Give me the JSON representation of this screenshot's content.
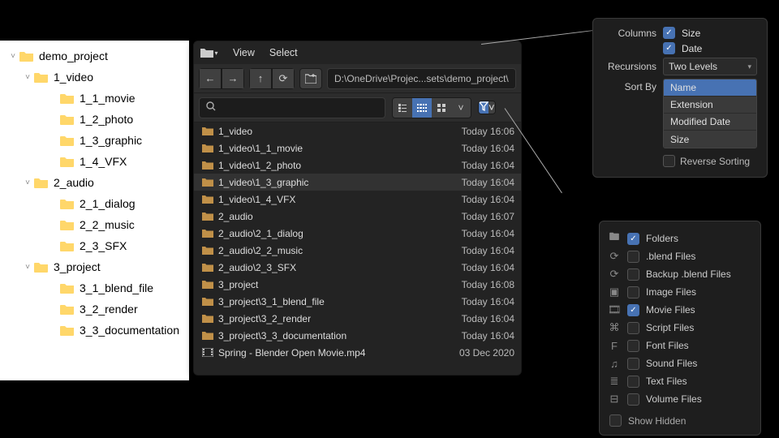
{
  "tree": {
    "root": {
      "label": "demo_project"
    },
    "nodes": [
      {
        "label": "1_video",
        "depth": 1,
        "expanded": true
      },
      {
        "label": "1_1_movie",
        "depth": 2
      },
      {
        "label": "1_2_photo",
        "depth": 2
      },
      {
        "label": "1_3_graphic",
        "depth": 2
      },
      {
        "label": "1_4_VFX",
        "depth": 2
      },
      {
        "label": "2_audio",
        "depth": 1,
        "expanded": true
      },
      {
        "label": "2_1_dialog",
        "depth": 2
      },
      {
        "label": "2_2_music",
        "depth": 2
      },
      {
        "label": "2_3_SFX",
        "depth": 2
      },
      {
        "label": "3_project",
        "depth": 1,
        "expanded": true
      },
      {
        "label": "3_1_blend_file",
        "depth": 2
      },
      {
        "label": "3_2_render",
        "depth": 2
      },
      {
        "label": "3_3_documentation",
        "depth": 2
      }
    ]
  },
  "browser": {
    "menu": {
      "view": "View",
      "select": "Select"
    },
    "path": "D:\\OneDrive\\Projec...sets\\demo_project\\",
    "files": [
      {
        "icon": "folder",
        "name": "1_video",
        "date": "Today 16:06"
      },
      {
        "icon": "folder",
        "name": "1_video\\1_1_movie",
        "date": "Today 16:04"
      },
      {
        "icon": "folder",
        "name": "1_video\\1_2_photo",
        "date": "Today 16:04"
      },
      {
        "icon": "folder",
        "name": "1_video\\1_3_graphic",
        "date": "Today 16:04",
        "hover": true
      },
      {
        "icon": "folder",
        "name": "1_video\\1_4_VFX",
        "date": "Today 16:04"
      },
      {
        "icon": "folder",
        "name": "2_audio",
        "date": "Today 16:07"
      },
      {
        "icon": "folder",
        "name": "2_audio\\2_1_dialog",
        "date": "Today 16:04"
      },
      {
        "icon": "folder",
        "name": "2_audio\\2_2_music",
        "date": "Today 16:04"
      },
      {
        "icon": "folder",
        "name": "2_audio\\2_3_SFX",
        "date": "Today 16:04"
      },
      {
        "icon": "folder",
        "name": "3_project",
        "date": "Today 16:08"
      },
      {
        "icon": "folder",
        "name": "3_project\\3_1_blend_file",
        "date": "Today 16:04"
      },
      {
        "icon": "folder",
        "name": "3_project\\3_2_render",
        "date": "Today 16:04"
      },
      {
        "icon": "folder",
        "name": "3_project\\3_3_documentation",
        "date": "Today 16:04"
      },
      {
        "icon": "movie",
        "name": "Spring - Blender Open Movie.mp4",
        "date": "03 Dec 2020"
      }
    ]
  },
  "settings": {
    "columns_label": "Columns",
    "size_label": "Size",
    "date_label": "Date",
    "size_checked": true,
    "date_checked": true,
    "recursions_label": "Recursions",
    "recursions_value": "Two Levels",
    "sortby_label": "Sort By",
    "sort_options": [
      "Name",
      "Extension",
      "Modified Date",
      "Size"
    ],
    "sort_selected": "Name",
    "reverse_label": "Reverse Sorting",
    "reverse_checked": false
  },
  "filters": {
    "items": [
      {
        "icon": "folders",
        "label": "Folders",
        "checked": true
      },
      {
        "icon": "blend",
        "label": ".blend Files",
        "checked": false
      },
      {
        "icon": "backup",
        "label": "Backup .blend Files",
        "checked": false
      },
      {
        "icon": "image",
        "label": "Image Files",
        "checked": false
      },
      {
        "icon": "movie",
        "label": "Movie Files",
        "checked": true
      },
      {
        "icon": "script",
        "label": "Script Files",
        "checked": false
      },
      {
        "icon": "font",
        "label": "Font Files",
        "checked": false
      },
      {
        "icon": "sound",
        "label": "Sound Files",
        "checked": false
      },
      {
        "icon": "text",
        "label": "Text Files",
        "checked": false
      },
      {
        "icon": "volume",
        "label": "Volume Files",
        "checked": false
      }
    ],
    "show_hidden_label": "Show Hidden",
    "show_hidden_checked": false
  },
  "icons": {
    "folders": "🖿",
    "blend": "⟳",
    "backup": "⟳",
    "image": "▣",
    "movie": "🎞",
    "script": "⌘",
    "font": "F",
    "sound": "♫",
    "text": "≣",
    "volume": "⊟"
  }
}
